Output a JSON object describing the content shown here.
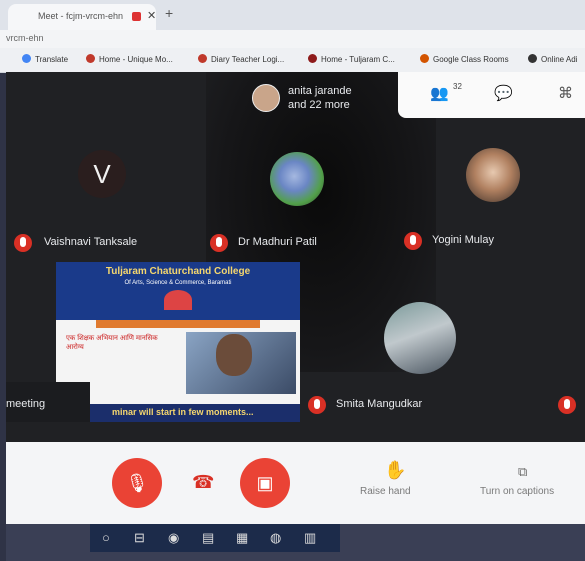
{
  "browser": {
    "tab_title": "Meet - fcjm-vrcm-ehn",
    "url": "vrcm-ehn",
    "bookmarks": [
      "Translate",
      "Home - Unique Mo...",
      "Diary Teacher Logi...",
      "Home - Tuljaram C...",
      "Google Class Rooms",
      "Online Adi"
    ]
  },
  "meeting": {
    "presenter_line1": "anita jarande",
    "presenter_line2": "and 22 more",
    "people_count": "32",
    "participants": [
      {
        "name": "Vaishnavi Tanksale",
        "initial": "V"
      },
      {
        "name": "Dr Madhuri Patil"
      },
      {
        "name": "Yogini Mulay"
      },
      {
        "name": "Smita Mangudkar"
      }
    ],
    "meeting_label": "meeting",
    "shared": {
      "title": "Tuljaram Chaturchand College",
      "subtitle": "Of Arts, Science & Commerce, Baramati",
      "red_text": "एक शिक्षक अभियान आणि मानसिक आरोग्य",
      "footer": "minar will start in few moments..."
    }
  },
  "controls": {
    "raise_hand": "Raise hand",
    "captions": "Turn on captions"
  },
  "colors": {
    "danger": "#ea4335",
    "tile_bg": "#202124",
    "controls_bg": "#f4f5f7"
  }
}
